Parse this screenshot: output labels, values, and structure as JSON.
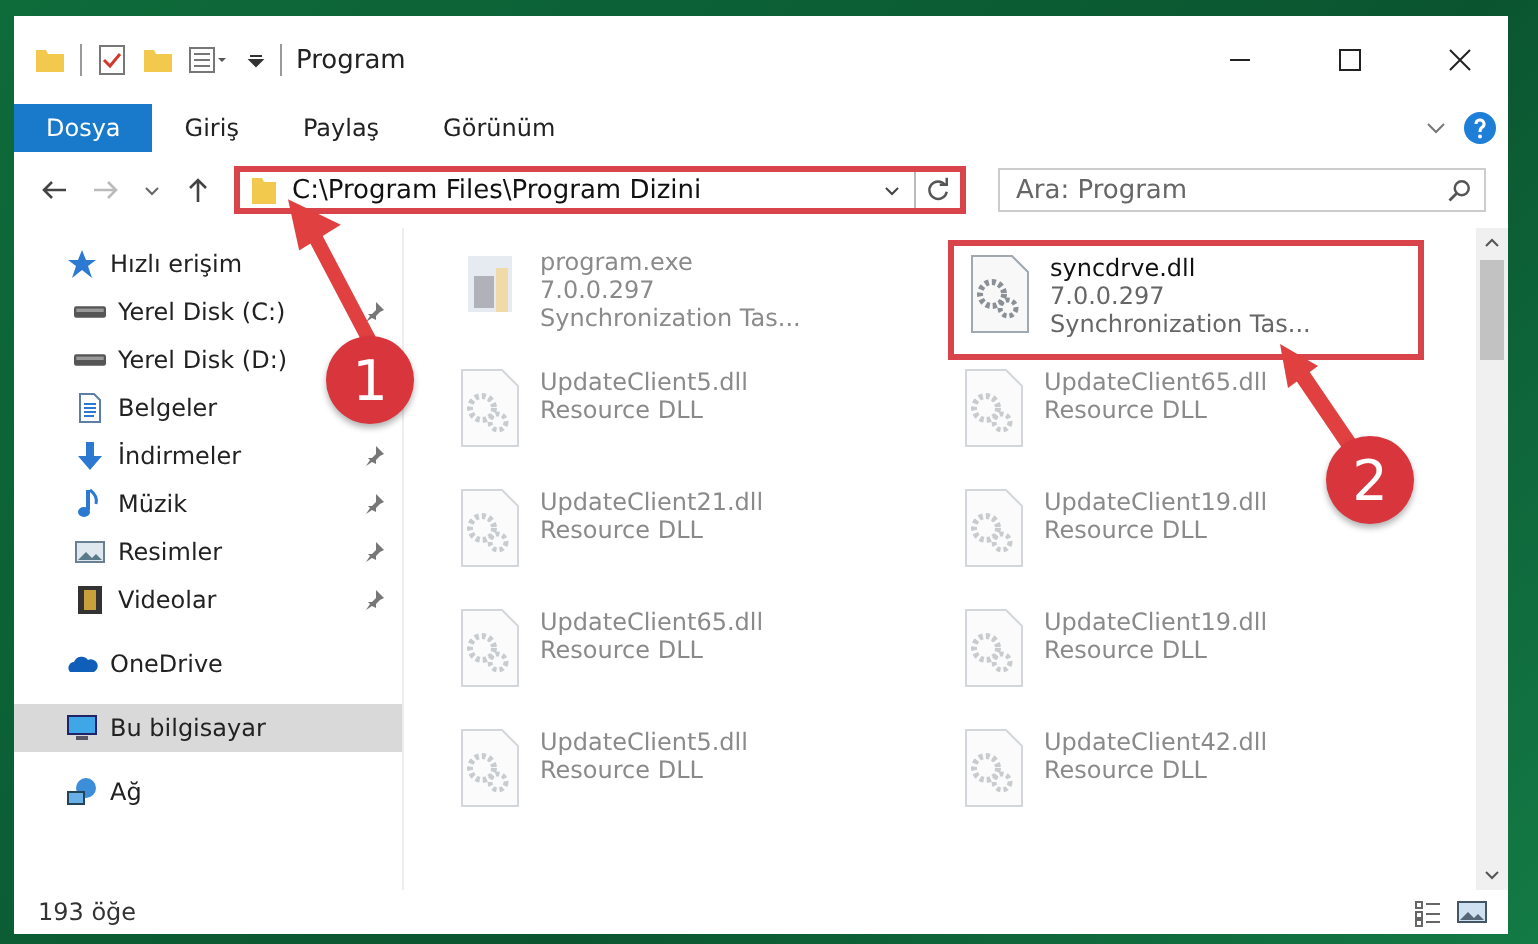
{
  "window": {
    "title": "Program"
  },
  "ribbon_tabs": [
    {
      "label": "Dosya",
      "selected": true
    },
    {
      "label": "Giriş",
      "selected": false
    },
    {
      "label": "Paylaş",
      "selected": false
    },
    {
      "label": "Görünüm",
      "selected": false
    }
  ],
  "address_bar": {
    "path": "C:\\Program Files\\Program Dizini",
    "highlighted": true
  },
  "search": {
    "placeholder": "Ara: Program"
  },
  "sidebar": {
    "items": [
      {
        "label": "Hızlı erişim",
        "kind": "star",
        "selected": false,
        "children": [
          {
            "label": "Yerel Disk (C:)",
            "kind": "drive",
            "pinned": true
          },
          {
            "label": "Yerel Disk (D:)",
            "kind": "drive"
          },
          {
            "label": "Belgeler",
            "kind": "document"
          },
          {
            "label": "İndirmeler",
            "kind": "download",
            "pinned": true
          },
          {
            "label": "Müzik",
            "kind": "music",
            "pinned": true
          },
          {
            "label": "Resimler",
            "kind": "image",
            "pinned": true
          },
          {
            "label": "Videolar",
            "kind": "video",
            "pinned": true
          }
        ]
      },
      {
        "label": "OneDrive",
        "kind": "cloud",
        "selected": false
      },
      {
        "label": "Bu bilgisayar",
        "kind": "computer",
        "selected": true
      },
      {
        "label": "Ağ",
        "kind": "network",
        "selected": false
      }
    ]
  },
  "files": [
    {
      "name": "program.exe",
      "lines": [
        "7.0.0.297",
        "Synchronization Tas..."
      ],
      "kind": "exe",
      "dimmed": true,
      "highlighted": false
    },
    {
      "name": "syncdrve.dll",
      "lines": [
        "7.0.0.297",
        "Synchronization Tas..."
      ],
      "kind": "dll",
      "dimmed": false,
      "highlighted": true
    },
    {
      "name": "UpdateClient5.dll",
      "lines": [
        "Resource DLL"
      ],
      "kind": "dll",
      "dimmed": true,
      "highlighted": false
    },
    {
      "name": "UpdateClient65.dll",
      "lines": [
        "Resource DLL"
      ],
      "kind": "dll",
      "dimmed": true,
      "highlighted": false
    },
    {
      "name": "UpdateClient21.dll",
      "lines": [
        "Resource DLL"
      ],
      "kind": "dll",
      "dimmed": true,
      "highlighted": false
    },
    {
      "name": "UpdateClient19.dll",
      "lines": [
        "Resource DLL"
      ],
      "kind": "dll",
      "dimmed": true,
      "highlighted": false
    },
    {
      "name": "UpdateClient65.dll",
      "lines": [
        "Resource DLL"
      ],
      "kind": "dll",
      "dimmed": true,
      "highlighted": false
    },
    {
      "name": "UpdateClient19.dll",
      "lines": [
        "Resource DLL"
      ],
      "kind": "dll",
      "dimmed": true,
      "highlighted": false
    },
    {
      "name": "UpdateClient5.dll",
      "lines": [
        "Resource DLL"
      ],
      "kind": "dll",
      "dimmed": true,
      "highlighted": false
    },
    {
      "name": "UpdateClient42.dll",
      "lines": [
        "Resource DLL"
      ],
      "kind": "dll",
      "dimmed": true,
      "highlighted": false
    }
  ],
  "status_bar": {
    "count": "193 öğe"
  },
  "callouts": [
    {
      "number": "1"
    },
    {
      "number": "2"
    }
  ]
}
